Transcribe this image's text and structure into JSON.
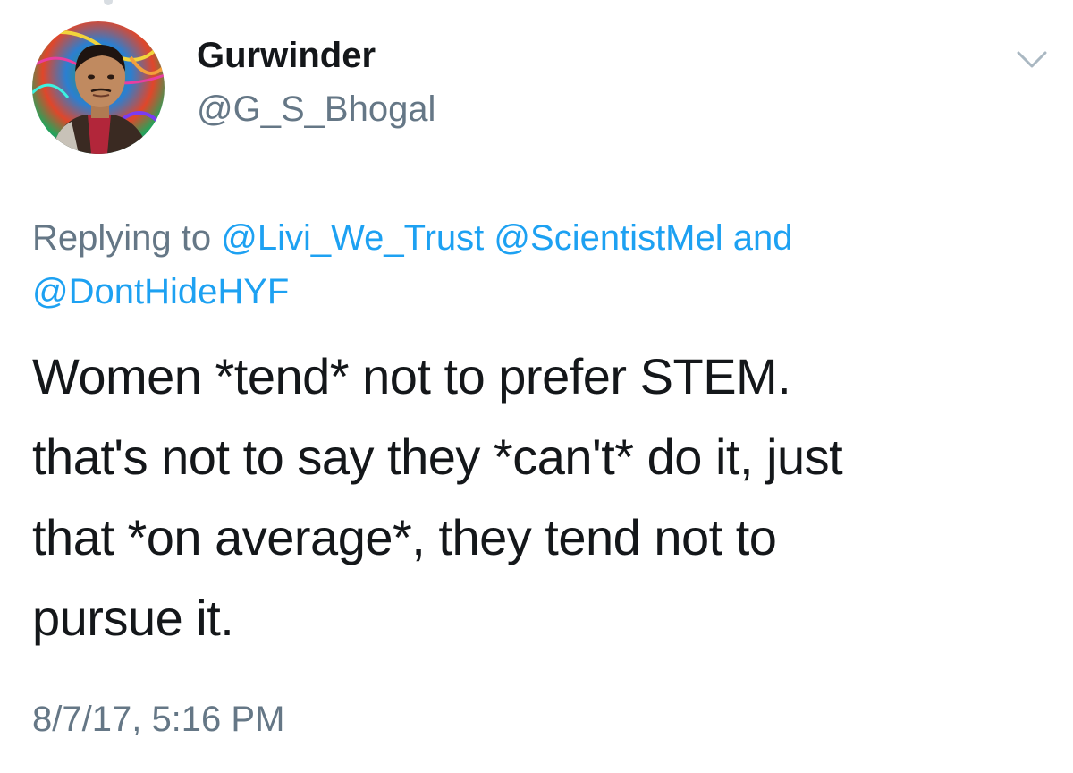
{
  "author": {
    "display_name": "Gurwinder",
    "handle": "@G_S_Bhogal",
    "avatar_icon": "profile-photo-avatar"
  },
  "reply_context": {
    "prefix": "Replying to",
    "mentions": [
      "@Livi_We_Trust",
      "@ScientistMel"
    ],
    "conjunction": "and",
    "last_mention": "@DontHideHYF"
  },
  "tweet": {
    "lines": [
      "Women *tend* not to prefer STEM.",
      "that's not to say they *can't* do it, just",
      "that *on average*, they tend not to",
      "pursue it."
    ],
    "timestamp": "8/7/17, 5:16 PM"
  },
  "menu": {
    "icon": "chevron-down-icon"
  },
  "colors": {
    "text_primary": "#14171a",
    "text_secondary": "#657786",
    "link": "#1da1f2",
    "background": "#ffffff"
  }
}
